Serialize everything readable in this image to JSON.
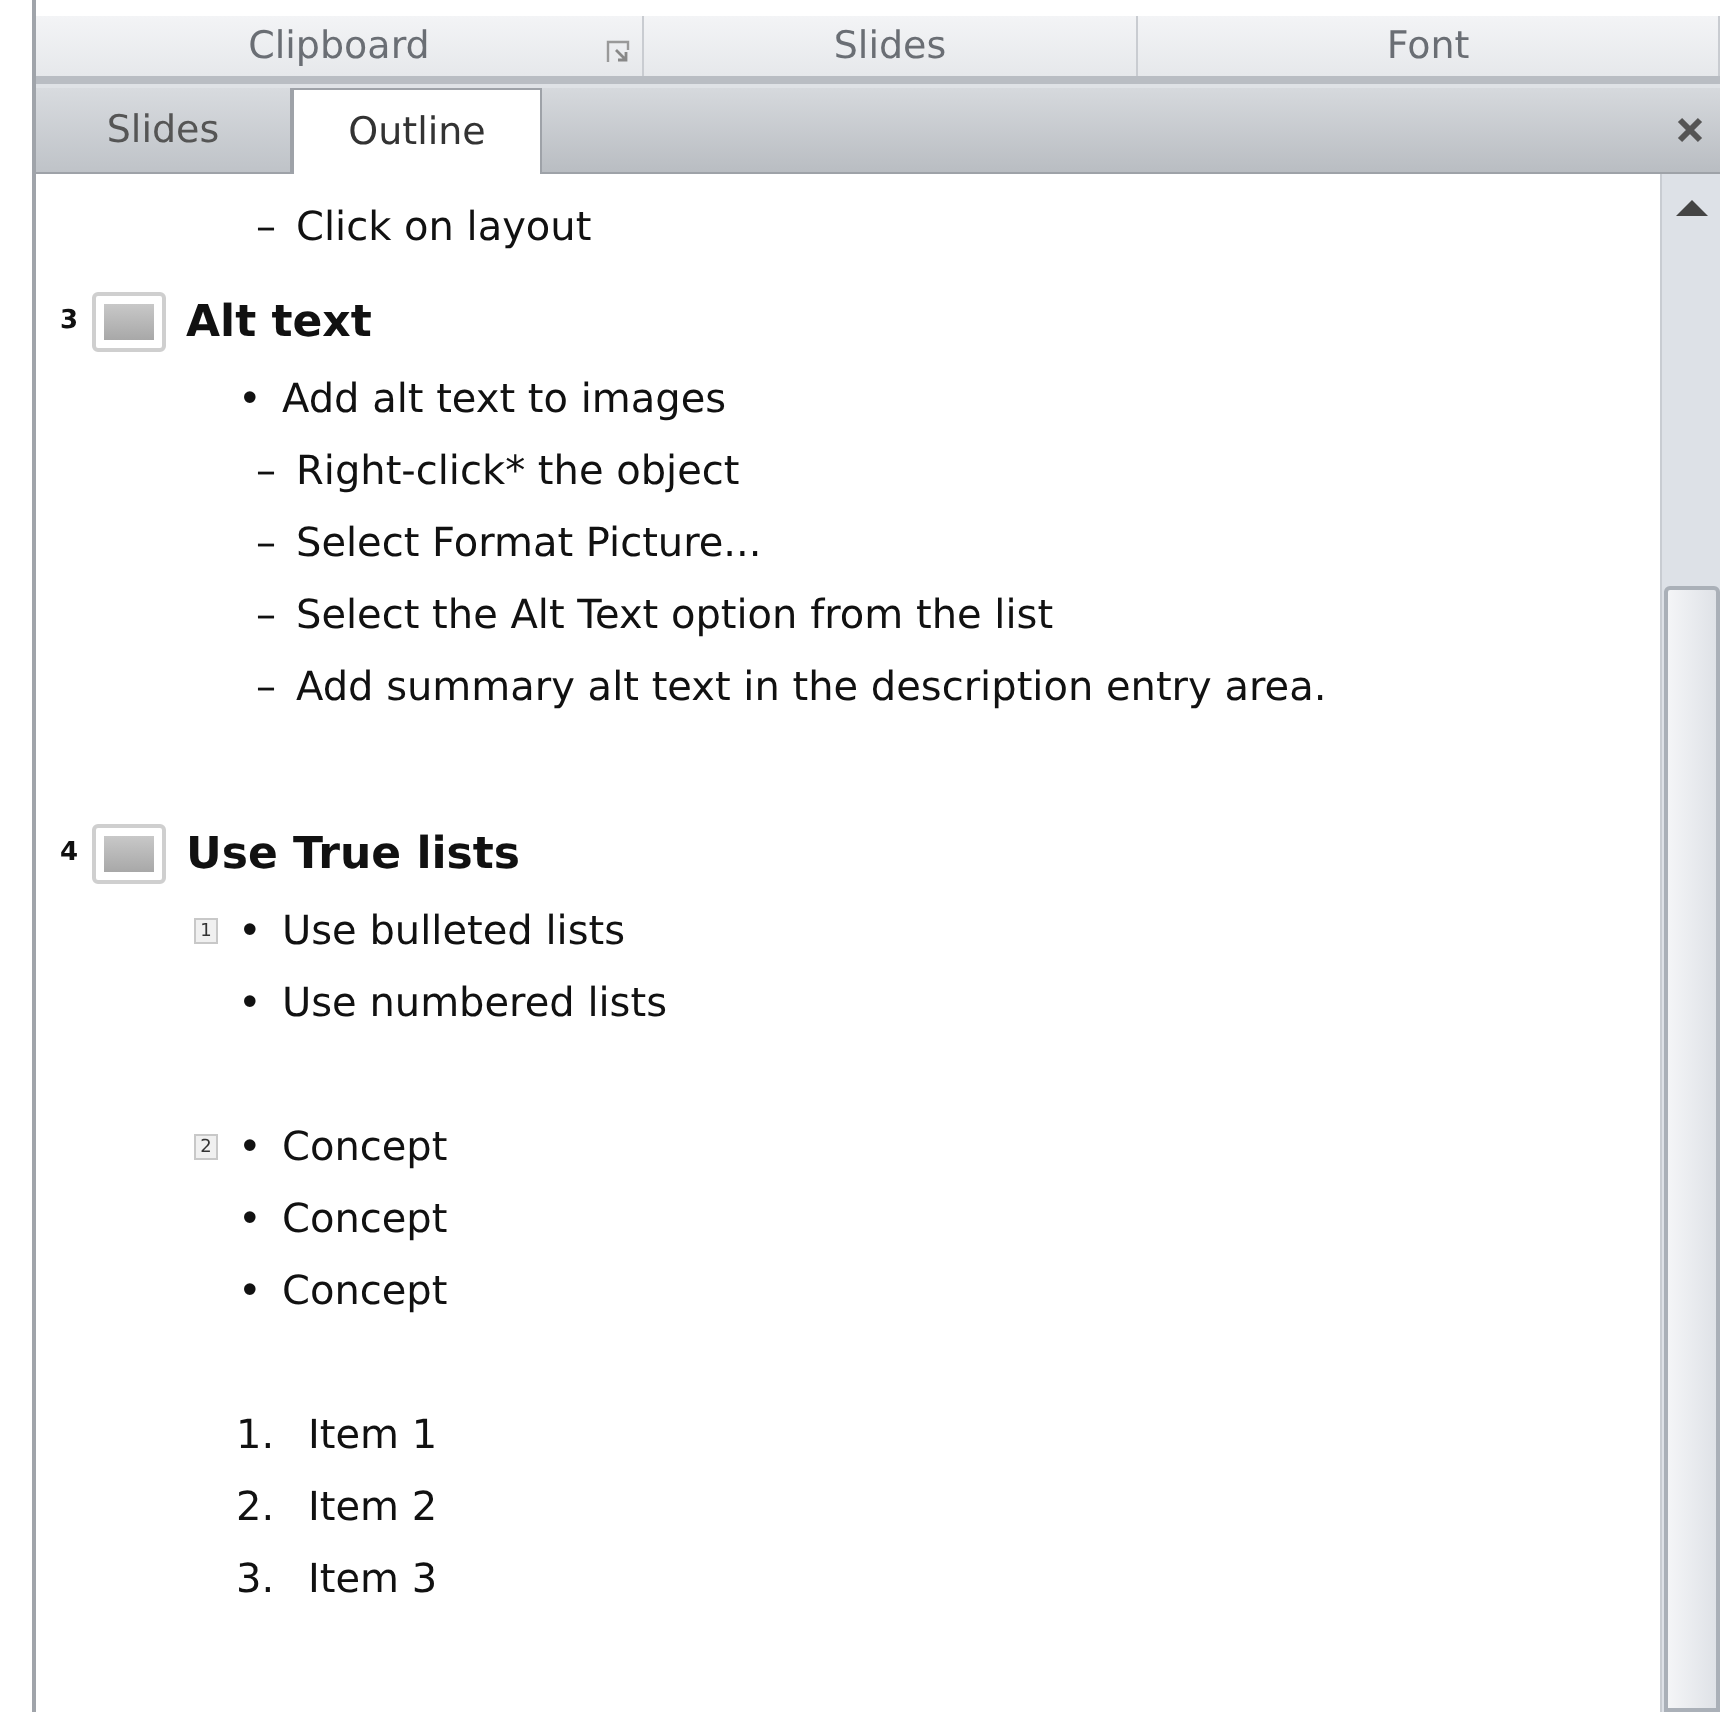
{
  "ribbon_groups": [
    {
      "kind": "launcher",
      "label": "Clipboard"
    },
    {
      "kind": "plain",
      "label": "Slides"
    },
    {
      "kind": "plain",
      "label": "Font"
    }
  ],
  "tabs": [
    {
      "label": "Slides",
      "selected": false
    },
    {
      "label": "Outline",
      "selected": true
    }
  ],
  "outline": [
    {
      "kind": "continuation",
      "children": [
        {
          "marker": "–",
          "text": "Click on layout"
        }
      ]
    },
    {
      "kind": "slide",
      "number": "3",
      "title": "Alt text",
      "children": [
        {
          "kind": "text",
          "marker": "•",
          "text": "Add alt text to images",
          "children": [
            {
              "marker": "–",
              "text": "Right-click* the object"
            },
            {
              "marker": "–",
              "text": "Select Format Picture..."
            },
            {
              "marker": "–",
              "text": "Select the Alt Text option from the list"
            },
            {
              "marker": "–",
              "text": "Add summary alt text in the description entry area."
            }
          ]
        },
        {
          "kind": "blank"
        }
      ]
    },
    {
      "kind": "slide",
      "number": "4",
      "title": "Use True lists",
      "children": [
        {
          "kind": "text",
          "marker": "•",
          "text": "Use bulleted lists",
          "tag": "1"
        },
        {
          "kind": "text",
          "marker": "•",
          "text": "Use numbered lists"
        },
        {
          "kind": "blank"
        },
        {
          "kind": "text",
          "marker": "•",
          "text": "Concept",
          "tag": "2"
        },
        {
          "kind": "text",
          "marker": "•",
          "text": "Concept"
        },
        {
          "kind": "text",
          "marker": "•",
          "text": "Concept"
        },
        {
          "kind": "blank"
        },
        {
          "kind": "text",
          "marker": "1.",
          "text": "Item 1"
        },
        {
          "kind": "text",
          "marker": "2.",
          "text": "Item 2"
        },
        {
          "kind": "text",
          "marker": "3.",
          "text": "Item 3"
        }
      ]
    }
  ]
}
